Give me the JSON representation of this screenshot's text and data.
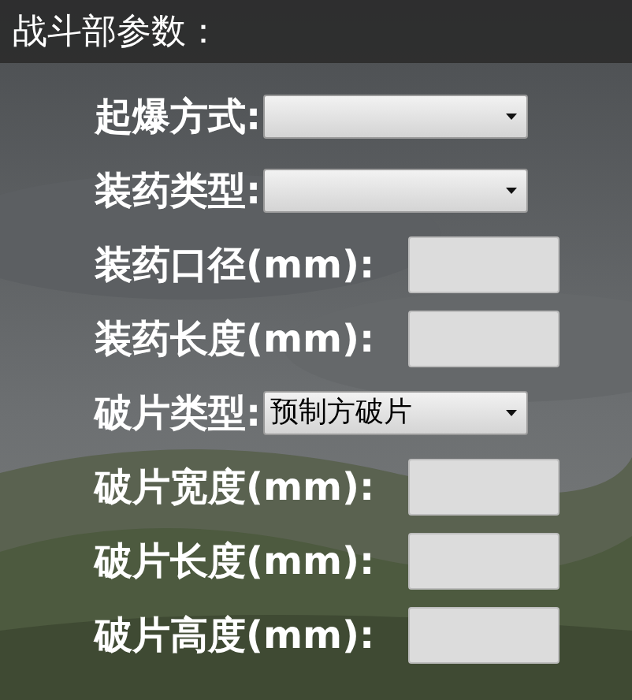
{
  "panel": {
    "title": "战斗部参数："
  },
  "fields": [
    {
      "label": "起爆方式:",
      "kind": "select"
    },
    {
      "label": "装药类型:",
      "kind": "select"
    },
    {
      "label": "装药口径(mm):",
      "kind": "input"
    },
    {
      "label": "装药长度(mm):",
      "kind": "input"
    },
    {
      "label": "破片类型:",
      "kind": "select",
      "value": "预制方破片"
    },
    {
      "label": "破片宽度(mm):",
      "kind": "input"
    },
    {
      "label": "破片长度(mm):",
      "kind": "input"
    },
    {
      "label": "破片高度(mm):",
      "kind": "input"
    }
  ]
}
